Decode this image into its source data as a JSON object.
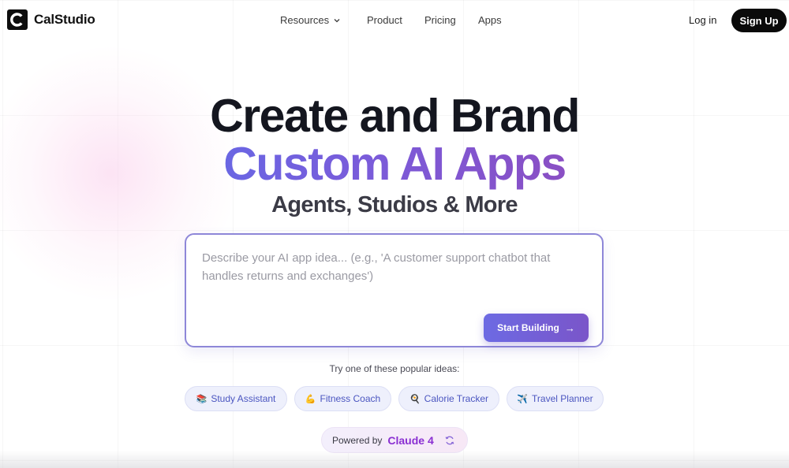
{
  "nav": {
    "brand": "CalStudio",
    "links": [
      {
        "label": "Resources",
        "has_dropdown": true
      },
      {
        "label": "Product"
      },
      {
        "label": "Pricing"
      },
      {
        "label": "Apps"
      }
    ],
    "login": "Log in",
    "signup": "Sign Up"
  },
  "hero": {
    "line1": "Create and Brand",
    "line2": "Custom AI Apps",
    "line3": "Agents, Studios & More"
  },
  "prompt": {
    "placeholder": "Describe your AI app idea... (e.g., 'A customer support chatbot that handles returns and exchanges')",
    "value": "",
    "button": "Start Building",
    "button_icon": "arrow-right-icon"
  },
  "suggestions": {
    "heading": "Try one of these popular ideas:",
    "items": [
      {
        "emoji": "📚",
        "label": "Study Assistant"
      },
      {
        "emoji": "💪",
        "label": "Fitness Coach"
      },
      {
        "emoji": "🍳",
        "label": "Calorie Tracker"
      },
      {
        "emoji": "✈️",
        "label": "Travel Planner"
      }
    ]
  },
  "powered": {
    "label": "Powered by",
    "model": "Claude 4",
    "icon": "refresh-icon"
  },
  "colors": {
    "accent_start": "#6a66e3",
    "accent_end": "#8a4fc4",
    "model_text": "#8a2fd2",
    "chip_text": "#4a55c0",
    "dark": "#0a0a0a"
  }
}
